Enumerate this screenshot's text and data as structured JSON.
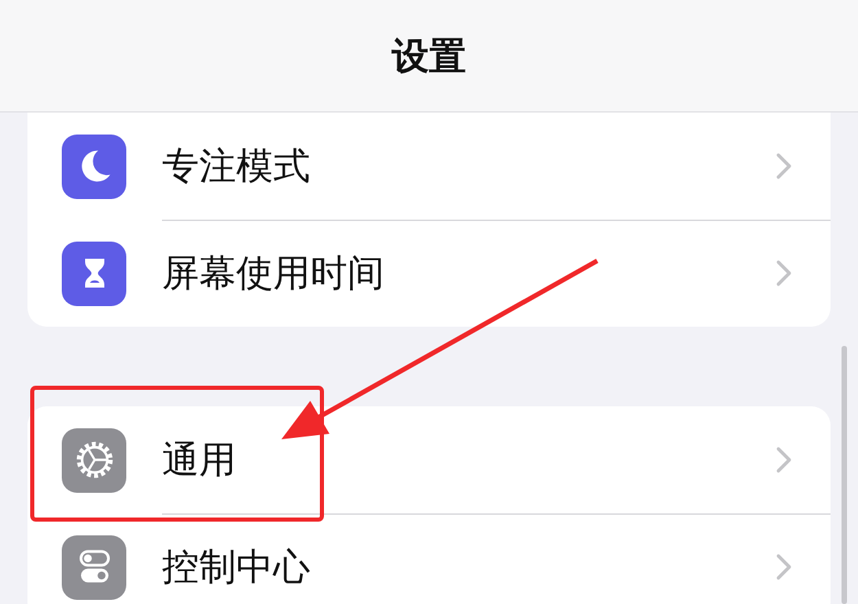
{
  "header": {
    "title": "设置"
  },
  "groups": [
    {
      "items": [
        {
          "label": "专注模式",
          "kind": "moon",
          "color": "#5e5ce6"
        },
        {
          "label": "屏幕使用时间",
          "kind": "hourglass",
          "color": "#5e5ce6"
        }
      ]
    },
    {
      "items": [
        {
          "label": "通用",
          "kind": "gear",
          "color": "#8e8e93"
        },
        {
          "label": "控制中心",
          "kind": "toggles",
          "color": "#8e8e93"
        }
      ]
    }
  ]
}
